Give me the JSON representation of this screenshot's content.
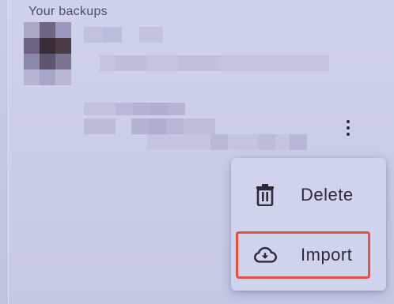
{
  "section": {
    "title": "Your backups"
  },
  "menu": {
    "items": [
      {
        "label": "Delete",
        "icon": "trash-icon"
      },
      {
        "label": "Import",
        "icon": "cloud-download-icon"
      }
    ]
  },
  "colors": {
    "background": "#c9cde8",
    "menu_background": "#d0d3ee",
    "text": "#2b2c38",
    "highlight": "#e3523c"
  }
}
